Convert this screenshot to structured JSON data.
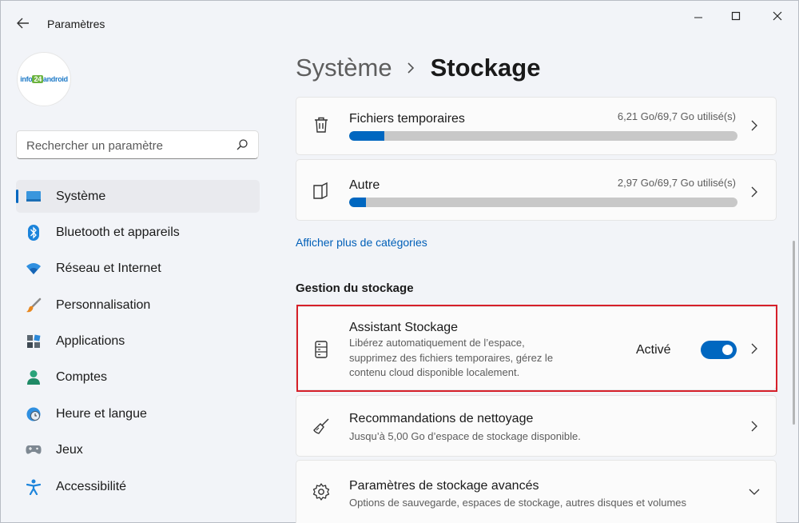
{
  "app": {
    "title": "Paramètres"
  },
  "profile": {
    "logo_text_a": "info",
    "logo_text_b": "24",
    "logo_text_c": "android"
  },
  "search": {
    "placeholder": "Rechercher un paramètre"
  },
  "sidebar": {
    "items": [
      {
        "label": "Système",
        "icon": "system-icon",
        "active": true
      },
      {
        "label": "Bluetooth et appareils",
        "icon": "bluetooth-icon"
      },
      {
        "label": "Réseau et Internet",
        "icon": "wifi-icon"
      },
      {
        "label": "Personnalisation",
        "icon": "brush-icon"
      },
      {
        "label": "Applications",
        "icon": "apps-icon"
      },
      {
        "label": "Comptes",
        "icon": "person-icon"
      },
      {
        "label": "Heure et langue",
        "icon": "clock-globe-icon"
      },
      {
        "label": "Jeux",
        "icon": "gamepad-icon"
      },
      {
        "label": "Accessibilité",
        "icon": "accessibility-icon"
      }
    ]
  },
  "breadcrumb": {
    "parent": "Système",
    "current": "Stockage"
  },
  "storage_categories": [
    {
      "title": "Fichiers temporaires",
      "usage": "6,21 Go/69,7 Go utilisé(s)",
      "fill_fraction": 0.09,
      "icon": "trash-icon"
    },
    {
      "title": "Autre",
      "usage": "2,97 Go/69,7 Go utilisé(s)",
      "fill_fraction": 0.043,
      "icon": "folder-icon"
    }
  ],
  "more_categories_link": "Afficher plus de catégories",
  "management": {
    "section_title": "Gestion du stockage",
    "storage_sense": {
      "title": "Assistant Stockage",
      "description_lines": [
        "Libérez automatiquement de l’espace,",
        "supprimez des fichiers temporaires, gérez le",
        "contenu cloud disponible localement."
      ],
      "status": "Activé",
      "toggle_on": true,
      "icon": "storage-drive-icon"
    },
    "cleanup": {
      "title": "Recommandations de nettoyage",
      "description": "Jusqu’à 5,00 Go d’espace de stockage disponible.",
      "icon": "broom-icon"
    },
    "advanced": {
      "title": "Paramètres de stockage avancés",
      "description": "Options de sauvegarde, espaces de stockage, autres disques et volumes",
      "icon": "gear-icon"
    }
  },
  "colors": {
    "accent": "#0067c0",
    "highlight_border": "#d6202a",
    "link": "#005fb8"
  }
}
